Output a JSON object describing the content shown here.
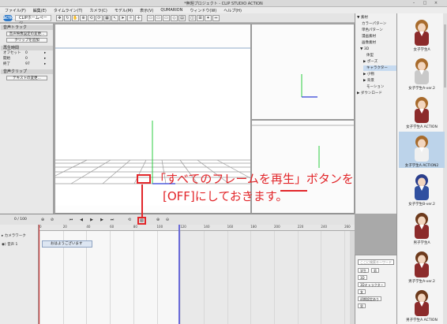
{
  "window": {
    "title": "*無題プロジェクト - CLIP STUDIO ACTION",
    "controls": [
      "–",
      "□",
      "×"
    ]
  },
  "menubar": [
    "ファイル(F)",
    "編集(E)",
    "タイムライン(T)",
    "カメラ(C)",
    "モデル(M)",
    "表示(V)",
    "QUMARION",
    "ウィンドウ(W)",
    "ヘルプ(H)"
  ],
  "toolbar": {
    "logo": "ACTION",
    "tab_label": "CLIPホームページ"
  },
  "left_panel": {
    "sound_track_header": "音声トラック",
    "sound_settings_button": "音声映像設定の変更...",
    "add_clip_button": "クリップを追加",
    "playback_header": "再生時間",
    "rows": [
      {
        "label": "オフセット",
        "value": "0"
      },
      {
        "label": "開始",
        "value": "0"
      },
      {
        "label": "終了",
        "value": "97"
      }
    ],
    "sound_clip_header": "音声クリップ",
    "text_change_button": "テキストの変更..."
  },
  "tree": [
    {
      "label": "素材",
      "indent": 0,
      "toggle": "▼"
    },
    {
      "label": "カラーパターン",
      "indent": 1,
      "toggle": ""
    },
    {
      "label": "単色パターン",
      "indent": 1,
      "toggle": ""
    },
    {
      "label": "漫画素材",
      "indent": 1,
      "toggle": ""
    },
    {
      "label": "画像素材",
      "indent": 1,
      "toggle": ""
    },
    {
      "label": "3D",
      "indent": 1,
      "toggle": "▼"
    },
    {
      "label": "体型",
      "indent": 2,
      "toggle": ""
    },
    {
      "label": "ポーズ",
      "indent": 2,
      "toggle": "▶"
    },
    {
      "label": "キャラクター",
      "indent": 2,
      "toggle": "",
      "selected": true
    },
    {
      "label": "小物",
      "indent": 2,
      "toggle": "▶"
    },
    {
      "label": "背景",
      "indent": 2,
      "toggle": "▶"
    },
    {
      "label": "モーション",
      "indent": 2,
      "toggle": ""
    },
    {
      "label": "ダウンロード",
      "indent": 0,
      "toggle": "▶"
    }
  ],
  "materials": [
    {
      "label": "女子学生A",
      "hair": "#a86b2c",
      "outfit": "#8c2b2b"
    },
    {
      "label": "女子学生A-ver.2",
      "hair": "#a86b2c",
      "outfit": "#c9c9c9"
    },
    {
      "label": "女子学生A ACTION",
      "hair": "#a86b2c",
      "outfit": "#8c2b2b"
    },
    {
      "label": "女子学生A ACTION2",
      "hair": "#a86b2c",
      "outfit": "#f0f0f0"
    },
    {
      "label": "女子学生B-ver.2",
      "hair": "#2a3e8c",
      "outfit": "#3050a0"
    },
    {
      "label": "男子学生A",
      "hair": "#6d3a1c",
      "outfit": "#8c2b2b"
    },
    {
      "label": "男子学生A-ver.2",
      "hair": "#6d3a1c",
      "outfit": "#8c2b2b"
    },
    {
      "label": "男子学生A ACTION",
      "hair": "#6d3a1c",
      "outfit": "#8c2b2b"
    }
  ],
  "search": {
    "placeholder": "ここに検索キーワード",
    "tags": [
      "学生",
      "男",
      "3D",
      "3Dキャラクター",
      "女",
      "初期設定あり",
      "男"
    ]
  },
  "timeline": {
    "frame_counter": "0 / 100",
    "track_header": "カメラワーク",
    "track_name": "音声 1",
    "clip_text": "おはようございます",
    "ruler_ticks": [
      "0",
      "20",
      "40",
      "60",
      "80",
      "100",
      "120",
      "140",
      "160",
      "180",
      "200",
      "220",
      "240",
      "260"
    ]
  },
  "annotation": {
    "line1": "「すべてのフレームを再生」ボタンを",
    "line2": "[OFF]にしておきます。",
    "color": "#e2262a"
  },
  "colors": {
    "accent": "#2c78c8",
    "playhead": "#e33c3c",
    "range_marker": "#6a6ad8"
  }
}
